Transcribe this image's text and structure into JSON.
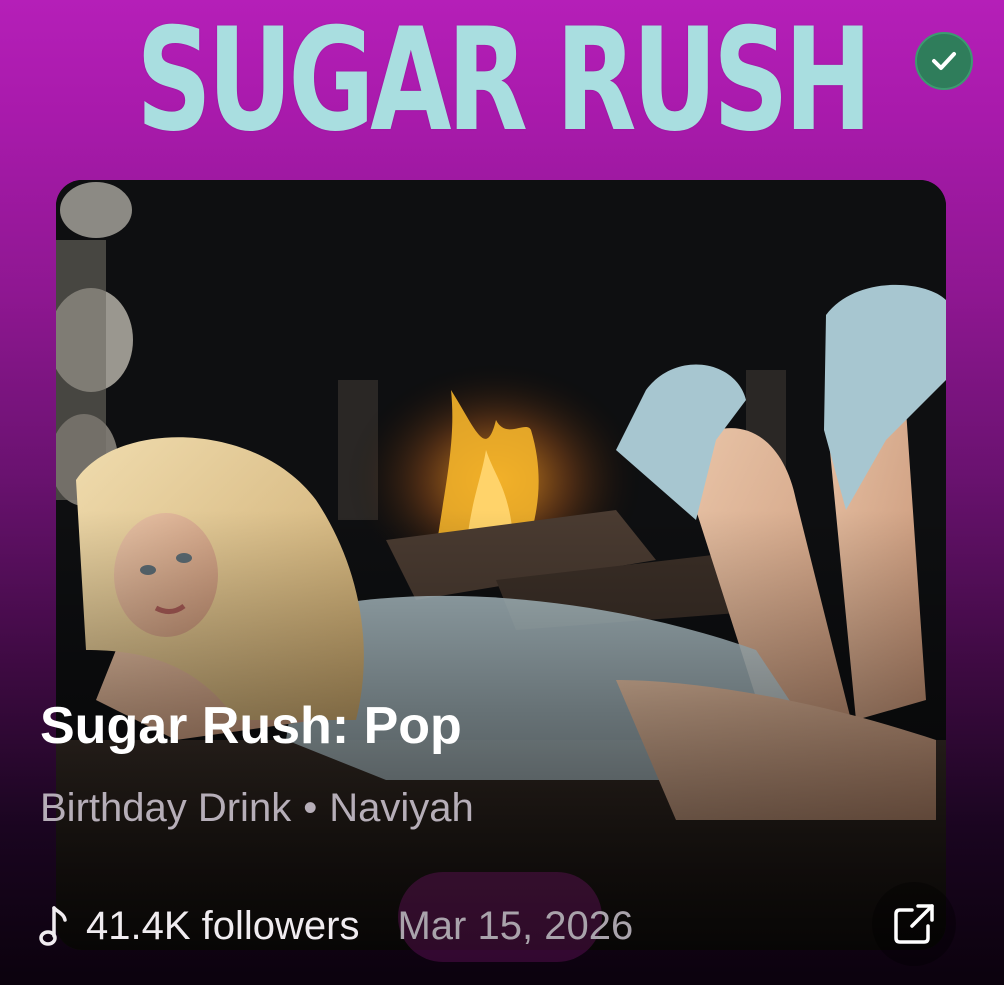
{
  "cover": {
    "title": "SUGAR RUSH"
  },
  "badge": {
    "icon": "checkmark-icon",
    "color": "#2f7d5b"
  },
  "playlist": {
    "title": "Sugar Rush: Pop",
    "subtitle_left": "Birthday Drink",
    "separator": "•",
    "subtitle_right": "Naviyah",
    "followers": "41.4K followers",
    "date": "Mar 15, 2026"
  },
  "icons": {
    "music": "music-note-icon",
    "external": "external-link-icon"
  },
  "colors": {
    "accent_top": "#b51fb8",
    "cover_title": "#a9dee0"
  }
}
